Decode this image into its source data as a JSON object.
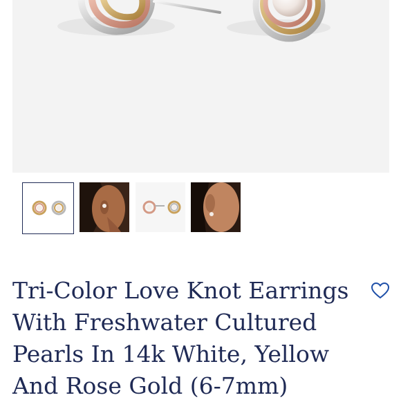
{
  "product": {
    "title": "Tri-Color Love Knot Earrings With Freshwater Cultured Pearls In 14k White, Yellow And Rose Gold (6-7mm)"
  },
  "gallery": {
    "selected_index": 0,
    "thumbnails": [
      {
        "icon": "earrings-pair-image"
      },
      {
        "icon": "model-wearing-earring-image"
      },
      {
        "icon": "earrings-side-view-image"
      },
      {
        "icon": "model-ear-closeup-image"
      }
    ]
  },
  "icons": {
    "favorite": "heart-outline-icon"
  },
  "colors": {
    "title_text": "#1f2a55",
    "accent_heart": "#1e4fa8",
    "hero_background": "#f3f3f3",
    "rose_gold": "#d49a86",
    "yellow_gold": "#c9a15c",
    "white_gold": "#cfcfcf"
  }
}
